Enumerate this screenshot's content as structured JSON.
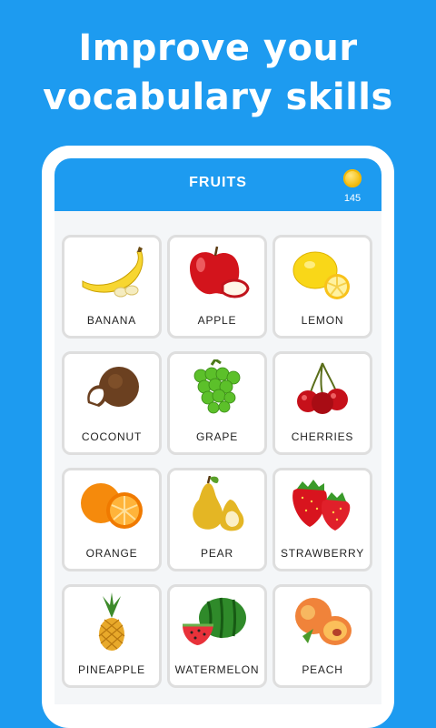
{
  "promo": {
    "headline_line1": "Improve your",
    "headline_line2": "vocabulary skills"
  },
  "app": {
    "title": "FRUITS",
    "coins": "145",
    "coin_icon": "gold-coin-icon"
  },
  "colors": {
    "brand_blue": "#1d9bf0",
    "card_border": "#dedede",
    "coin_gold": "#f6c21c"
  },
  "fruits": [
    {
      "label": "BANANA",
      "icon": "banana-icon"
    },
    {
      "label": "APPLE",
      "icon": "apple-icon"
    },
    {
      "label": "LEMON",
      "icon": "lemon-icon"
    },
    {
      "label": "COCONUT",
      "icon": "coconut-icon"
    },
    {
      "label": "GRAPE",
      "icon": "grape-icon"
    },
    {
      "label": "CHERRIES",
      "icon": "cherries-icon"
    },
    {
      "label": "ORANGE",
      "icon": "orange-icon"
    },
    {
      "label": "PEAR",
      "icon": "pear-icon"
    },
    {
      "label": "STRAWBERRY",
      "icon": "strawberry-icon"
    },
    {
      "label": "PINEAPPLE",
      "icon": "pineapple-icon"
    },
    {
      "label": "WATERMELON",
      "icon": "watermelon-icon"
    },
    {
      "label": "PEACH",
      "icon": "peach-icon"
    }
  ]
}
